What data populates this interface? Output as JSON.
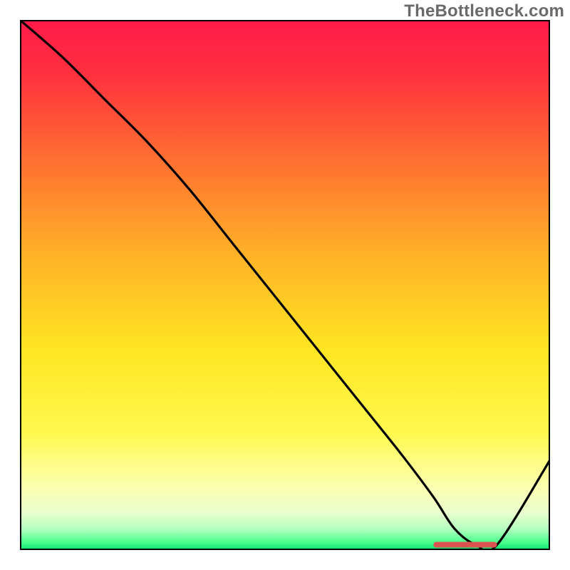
{
  "watermark": {
    "text": "TheBottleneck.com"
  },
  "chart_data": {
    "type": "line",
    "title": "",
    "xlabel": "",
    "ylabel": "",
    "xlim": [
      0,
      100
    ],
    "ylim": [
      0,
      100
    ],
    "x": [
      0,
      8,
      16,
      24,
      32,
      40,
      48,
      56,
      64,
      72,
      78,
      82,
      86,
      90,
      100
    ],
    "values": [
      100,
      93,
      85,
      77,
      68,
      58,
      48,
      38,
      28,
      18,
      10,
      4,
      1,
      1,
      17
    ],
    "optimal_band": {
      "x_start": 78,
      "x_end": 90,
      "y": 1
    },
    "gradient_stops": [
      {
        "offset": 0.0,
        "color": "#ff1b49"
      },
      {
        "offset": 0.1,
        "color": "#ff2f3f"
      },
      {
        "offset": 0.25,
        "color": "#ff6a32"
      },
      {
        "offset": 0.45,
        "color": "#ffb427"
      },
      {
        "offset": 0.62,
        "color": "#ffe522"
      },
      {
        "offset": 0.78,
        "color": "#fff94f"
      },
      {
        "offset": 0.88,
        "color": "#fcffb0"
      },
      {
        "offset": 0.93,
        "color": "#e9ffce"
      },
      {
        "offset": 0.96,
        "color": "#b6ffc0"
      },
      {
        "offset": 0.985,
        "color": "#4cff8e"
      },
      {
        "offset": 1.0,
        "color": "#09e06e"
      }
    ],
    "annotations": [],
    "legend": []
  }
}
